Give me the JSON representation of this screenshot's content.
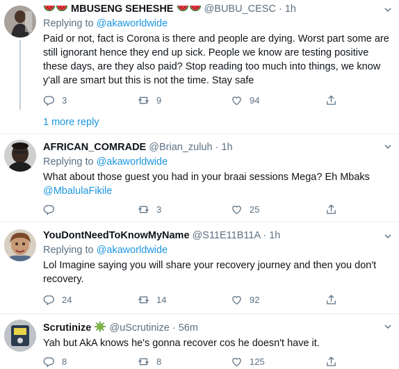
{
  "tweets": [
    {
      "name": "MBUSENG SEHESHE",
      "handle": "@BUBU_CESC",
      "time": "1h",
      "replying_label": "Replying to ",
      "replying_to": "@akaworldwide",
      "text": "Paid or not, fact is Corona is there and people are dying. Worst part some are still ignorant hence they end up sick. People we know are testing positive these days, are they also paid? Stop reading too much into things, we know y'all are smart but this is not the time. Stay safe",
      "replies": "3",
      "retweets": "9",
      "likes": "94"
    },
    {
      "name": "AFRICAN_COMRADE",
      "handle": "@Brian_zuluh",
      "time": "1h",
      "replying_label": "Replying to ",
      "replying_to": "@akaworldwide",
      "text": "What about those guest you had in your braai sessions Mega? Eh Mbaks",
      "mention": "@MbalulaFikile",
      "replies": "",
      "retweets": "3",
      "likes": "25"
    },
    {
      "name": "YouDontNeedToKnowMyName",
      "handle": "@S11E11B11A",
      "time": "1h",
      "replying_label": "Replying to ",
      "replying_to": "@akaworldwide",
      "text": "Lol Imagine saying you will share your recovery journey and then you don't recovery.",
      "replies": "24",
      "retweets": "14",
      "likes": "92"
    },
    {
      "name": "Scrutinize",
      "handle": "@uScrutinize",
      "time": "56m",
      "text": "Yah but AkA knows he's gonna recover cos he doesn't have it.",
      "replies": "8",
      "retweets": "8",
      "likes": "125"
    }
  ],
  "more_reply": "1 more reply",
  "dot": "·",
  "icons": {
    "reply": "reply-icon",
    "retweet": "retweet-icon",
    "like": "heart-icon",
    "share": "share-icon",
    "caret": "chevron-down-icon"
  },
  "colors": {
    "link": "#1b95e0",
    "secondary": "#5b7083",
    "divider": "#e6ecf0"
  }
}
